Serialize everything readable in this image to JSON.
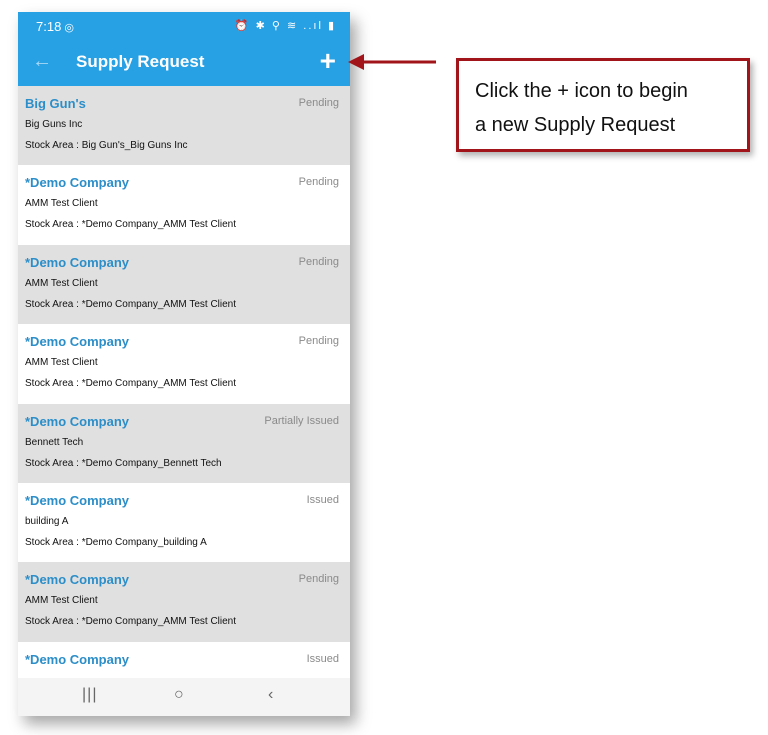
{
  "status_bar": {
    "time": "7:18",
    "time_icon": "◎",
    "right_icons": "⏰ ✱ ⚲ ≋ ..ıl ▮"
  },
  "header": {
    "title": "Supply Request",
    "back_icon": "←",
    "add_icon": "+"
  },
  "requests": [
    {
      "company": "Big Gun's",
      "status": "Pending",
      "client": "Big Guns Inc",
      "stock_area": "Stock Area : Big Gun's_Big Guns Inc"
    },
    {
      "company": "*Demo Company",
      "status": "Pending",
      "client": "AMM Test Client",
      "stock_area": "Stock Area : *Demo Company_AMM Test Client"
    },
    {
      "company": "*Demo Company",
      "status": "Pending",
      "client": "AMM Test Client",
      "stock_area": "Stock Area : *Demo Company_AMM Test Client"
    },
    {
      "company": "*Demo Company",
      "status": "Pending",
      "client": "AMM Test Client",
      "stock_area": "Stock Area : *Demo Company_AMM Test Client"
    },
    {
      "company": "*Demo Company",
      "status": "Partially Issued",
      "client": "Bennett Tech",
      "stock_area": "Stock Area : *Demo Company_Bennett Tech"
    },
    {
      "company": "*Demo Company",
      "status": "Issued",
      "client": "building A",
      "stock_area": "Stock Area : *Demo Company_building A"
    },
    {
      "company": "*Demo Company",
      "status": "Pending",
      "client": "AMM Test Client",
      "stock_area": "Stock Area : *Demo Company_AMM Test Client"
    },
    {
      "company": "*Demo Company",
      "status": "Issued",
      "client": "",
      "stock_area": ""
    }
  ],
  "nav_bar": {
    "recent_icon": "|||",
    "home_icon": "○",
    "back_icon": "‹"
  },
  "callout": {
    "line1": "Click the + icon to begin",
    "line2": "a new Supply Request"
  },
  "colors": {
    "app_bar": "#27a0e4",
    "company_text": "#2b8ec9",
    "callout_border": "#a0141a",
    "row_alt": "#e0e0e0"
  }
}
